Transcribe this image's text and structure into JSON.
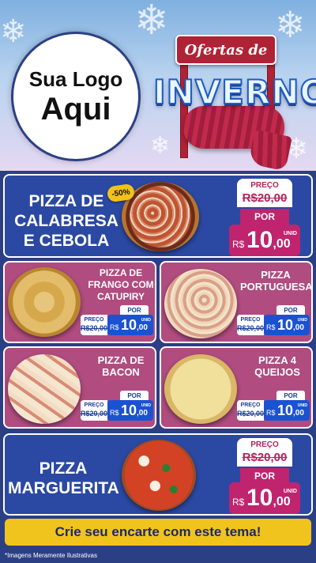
{
  "header": {
    "logo_line1": "Sua Logo",
    "logo_line2": "Aqui",
    "banner_small": "Ofertas de",
    "banner_big": "INVERNO"
  },
  "offers": [
    {
      "name": "PIZZA DE CALABRESA E CEBOLA",
      "discount": "-50%",
      "price_label": "PREÇO",
      "old_price": "R$20,00",
      "por_label": "POR",
      "currency": "R$",
      "price_int": "10",
      "price_cents": ",00",
      "unit": "UNID"
    },
    {
      "name": "PIZZA DE FRANGO COM CATUPIRY",
      "price_label": "PREÇO",
      "old_price": "R$20,00",
      "por_label": "POR",
      "currency": "R$",
      "price_int": "10",
      "price_cents": ",00",
      "unit": "UNID"
    },
    {
      "name": "PIZZA PORTUGUESA",
      "price_label": "PREÇO",
      "old_price": "R$20,00",
      "por_label": "POR",
      "currency": "R$",
      "price_int": "10",
      "price_cents": ",00",
      "unit": "UNID"
    },
    {
      "name": "PIZZA DE BACON",
      "price_label": "PREÇO",
      "old_price": "R$20,00",
      "por_label": "POR",
      "currency": "R$",
      "price_int": "10",
      "price_cents": ",00",
      "unit": "UNID"
    },
    {
      "name": "PIZZA 4 QUEIJOS",
      "price_label": "PREÇO",
      "old_price": "R$20,00",
      "por_label": "POR",
      "currency": "R$",
      "price_int": "10",
      "price_cents": ",00",
      "unit": "UNID"
    },
    {
      "name": "PIZZA MARGUERITA",
      "price_label": "PREÇO",
      "old_price": "R$20,00",
      "por_label": "POR",
      "currency": "R$",
      "price_int": "10",
      "price_cents": ",00",
      "unit": "UNID"
    }
  ],
  "footer": {
    "cta": "Crie seu encarte com este tema!",
    "disclaimer": "*Imagens Meramente Ilustrativas"
  },
  "colors": {
    "background": "#2b3f84",
    "big_card": "#2b49a3",
    "small_card": "#b04c7f",
    "price_magenta": "#c0246e",
    "price_blue": "#1b52d2",
    "cta_yellow": "#f0c41c"
  }
}
